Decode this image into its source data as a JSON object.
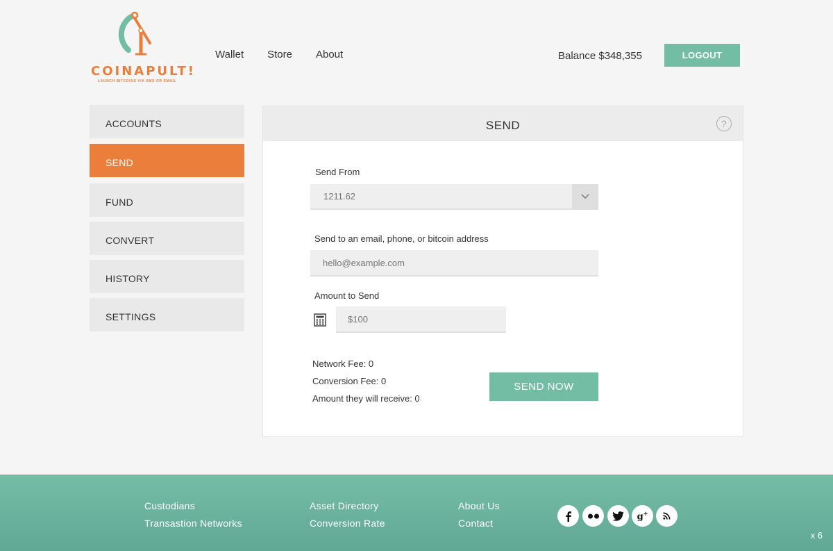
{
  "brand": {
    "name": "COINAPULT!",
    "tagline": "LAUNCH BITCOINS VIA SMS OR EMAIL",
    "accent": "#ea7e3a",
    "teal": "#74bda5"
  },
  "nav": {
    "items": [
      "Wallet",
      "Store",
      "About"
    ]
  },
  "header": {
    "balance": "Balance $348,355",
    "logout_label": "LOGOUT"
  },
  "sidebar": {
    "items": [
      {
        "label": "ACCOUNTS"
      },
      {
        "label": "SEND"
      },
      {
        "label": "FUND"
      },
      {
        "label": "CONVERT"
      },
      {
        "label": "HISTORY"
      },
      {
        "label": "SETTINGS"
      }
    ],
    "active": "SEND"
  },
  "panel": {
    "title": "SEND",
    "help_icon": "question-circle-icon",
    "send_from": {
      "label": "Send From",
      "value": "1211.62"
    },
    "send_to": {
      "label": "Send to an email, phone, or bitcoin address",
      "placeholder": "hello@example.com"
    },
    "amount": {
      "label": "Amount to Send",
      "placeholder": "$100",
      "icon": "calculator-icon"
    },
    "fees": {
      "network": "Network Fee: 0",
      "conversion": "Conversion Fee: 0",
      "receive": "Amount they will receive: 0"
    },
    "send_now_label": "SEND NOW"
  },
  "footer": {
    "col1": [
      "Custodians",
      "Transastion Networks"
    ],
    "col2": [
      "Asset Directory",
      "Conversion Rate"
    ],
    "col3": [
      "About Us",
      "Contact"
    ],
    "social": [
      "facebook-icon",
      "flickr-icon",
      "twitter-icon",
      "google-plus-icon",
      "rss-icon"
    ],
    "zoom": "x 6"
  }
}
